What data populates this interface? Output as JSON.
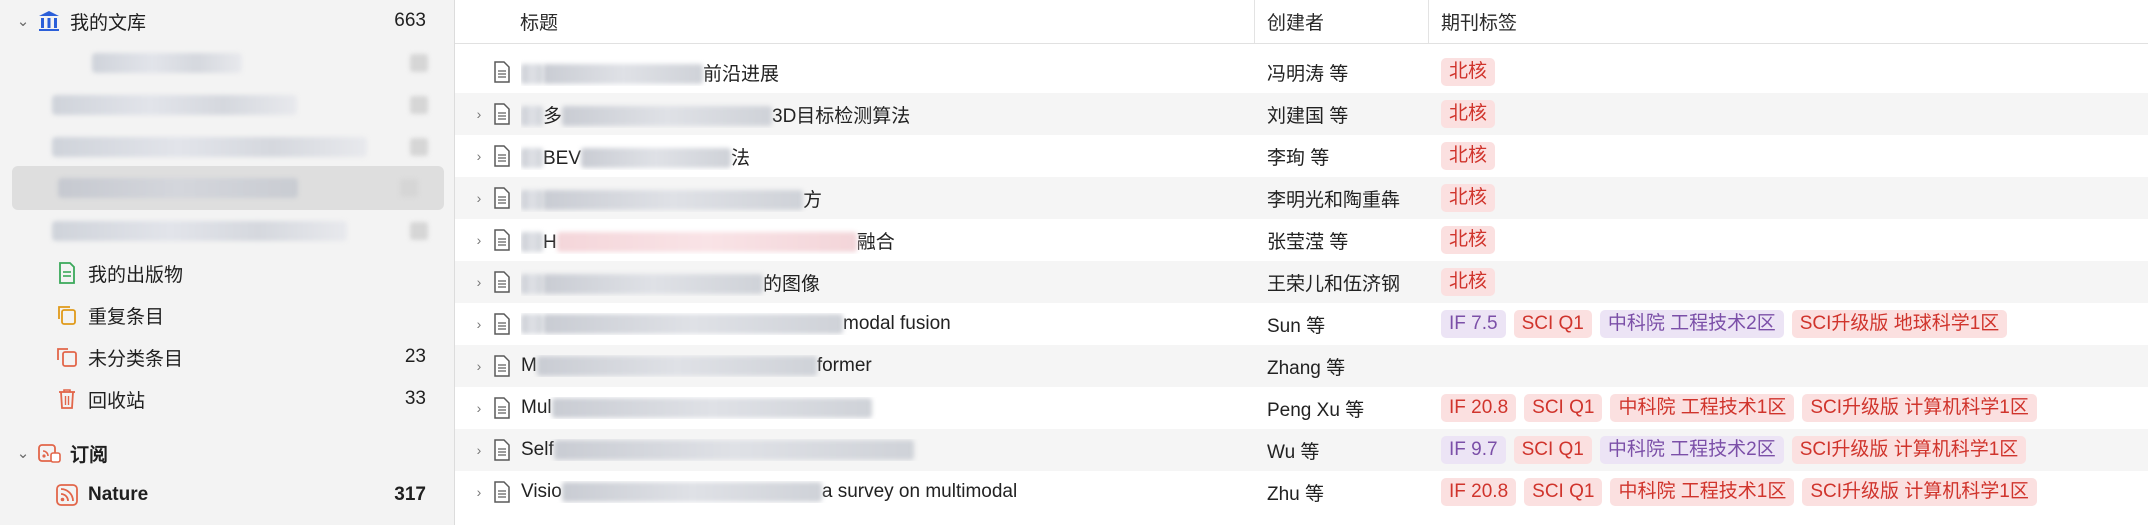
{
  "sidebar": {
    "library": {
      "label": "我的文库",
      "count": "663",
      "icon": "library-icon"
    },
    "my_publications": {
      "label": "我的出版物",
      "icon": "publication-icon"
    },
    "duplicates": {
      "label": "重复条目",
      "icon": "duplicate-icon"
    },
    "unfiled": {
      "label": "未分类条目",
      "count": "23",
      "icon": "unfiled-icon"
    },
    "trash": {
      "label": "回收站",
      "count": "33",
      "icon": "trash-icon"
    },
    "feeds": {
      "label": "订阅",
      "icon": "feed-icon"
    },
    "nature": {
      "label": "Nature",
      "count": "317",
      "icon": "rss-icon"
    }
  },
  "columns": {
    "title": "标题",
    "creator": "创建者",
    "tags": "期刊标签"
  },
  "rows": [
    {
      "title_pre": "",
      "title_post": "前沿进展",
      "creator": "冯明涛 等",
      "tags": [
        {
          "text": "北核",
          "color": "red"
        }
      ]
    },
    {
      "title_pre": "多",
      "title_post": "3D目标检测算法",
      "creator": "刘建国 等",
      "tags": [
        {
          "text": "北核",
          "color": "red"
        }
      ]
    },
    {
      "title_pre": "BEV",
      "title_post": "法",
      "creator": "李珣 等",
      "tags": [
        {
          "text": "北核",
          "color": "red"
        }
      ]
    },
    {
      "title_pre": "",
      "title_post": "方",
      "creator": "李明光和陶重犇",
      "tags": [
        {
          "text": "北核",
          "color": "red"
        }
      ]
    },
    {
      "title_pre": "H",
      "title_post": "融合",
      "creator": "张莹滢 等",
      "tags": [
        {
          "text": "北核",
          "color": "red"
        }
      ]
    },
    {
      "title_pre": "",
      "title_post": "的图像",
      "creator": "王荣儿和伍济钢",
      "tags": [
        {
          "text": "北核",
          "color": "red"
        }
      ]
    },
    {
      "title_pre": "",
      "title_post": "modal fusion",
      "creator": "Sun 等",
      "tags": [
        {
          "text": "IF 7.5",
          "color": "purple"
        },
        {
          "text": "SCI Q1",
          "color": "red"
        },
        {
          "text": "中科院 工程技术2区",
          "color": "purple"
        },
        {
          "text": "SCI升级版 地球科学1区",
          "color": "red"
        }
      ]
    },
    {
      "title_pre": "M",
      "title_post": "former",
      "creator": "Zhang 等",
      "tags": []
    },
    {
      "title_pre": "Mul",
      "title_post": "",
      "creator": "Peng Xu 等",
      "tags": [
        {
          "text": "IF 20.8",
          "color": "red"
        },
        {
          "text": "SCI Q1",
          "color": "red"
        },
        {
          "text": "中科院 工程技术1区",
          "color": "red"
        },
        {
          "text": "SCI升级版 计算机科学1区",
          "color": "red"
        }
      ]
    },
    {
      "title_pre": "Self",
      "title_post": "",
      "creator": "Wu 等",
      "tags": [
        {
          "text": "IF 9.7",
          "color": "purple"
        },
        {
          "text": "SCI Q1",
          "color": "red"
        },
        {
          "text": "中科院 工程技术2区",
          "color": "purple"
        },
        {
          "text": "SCI升级版 计算机科学1区",
          "color": "red"
        }
      ]
    },
    {
      "title_pre": "Visio",
      "title_post": "a survey on multimodal",
      "creator": "Zhu 等",
      "tags": [
        {
          "text": "IF 20.8",
          "color": "red"
        },
        {
          "text": "SCI Q1",
          "color": "red"
        },
        {
          "text": "中科院 工程技术1区",
          "color": "red"
        },
        {
          "text": "SCI升级版 计算机科学1区",
          "color": "red"
        }
      ]
    }
  ],
  "colors": {
    "tag_red_bg": "#fbe0e0",
    "tag_red_fg": "#d0342c",
    "tag_purple_bg": "#ece4f5",
    "tag_purple_fg": "#7b4fa8",
    "accent_blue": "#2b5fd9"
  }
}
